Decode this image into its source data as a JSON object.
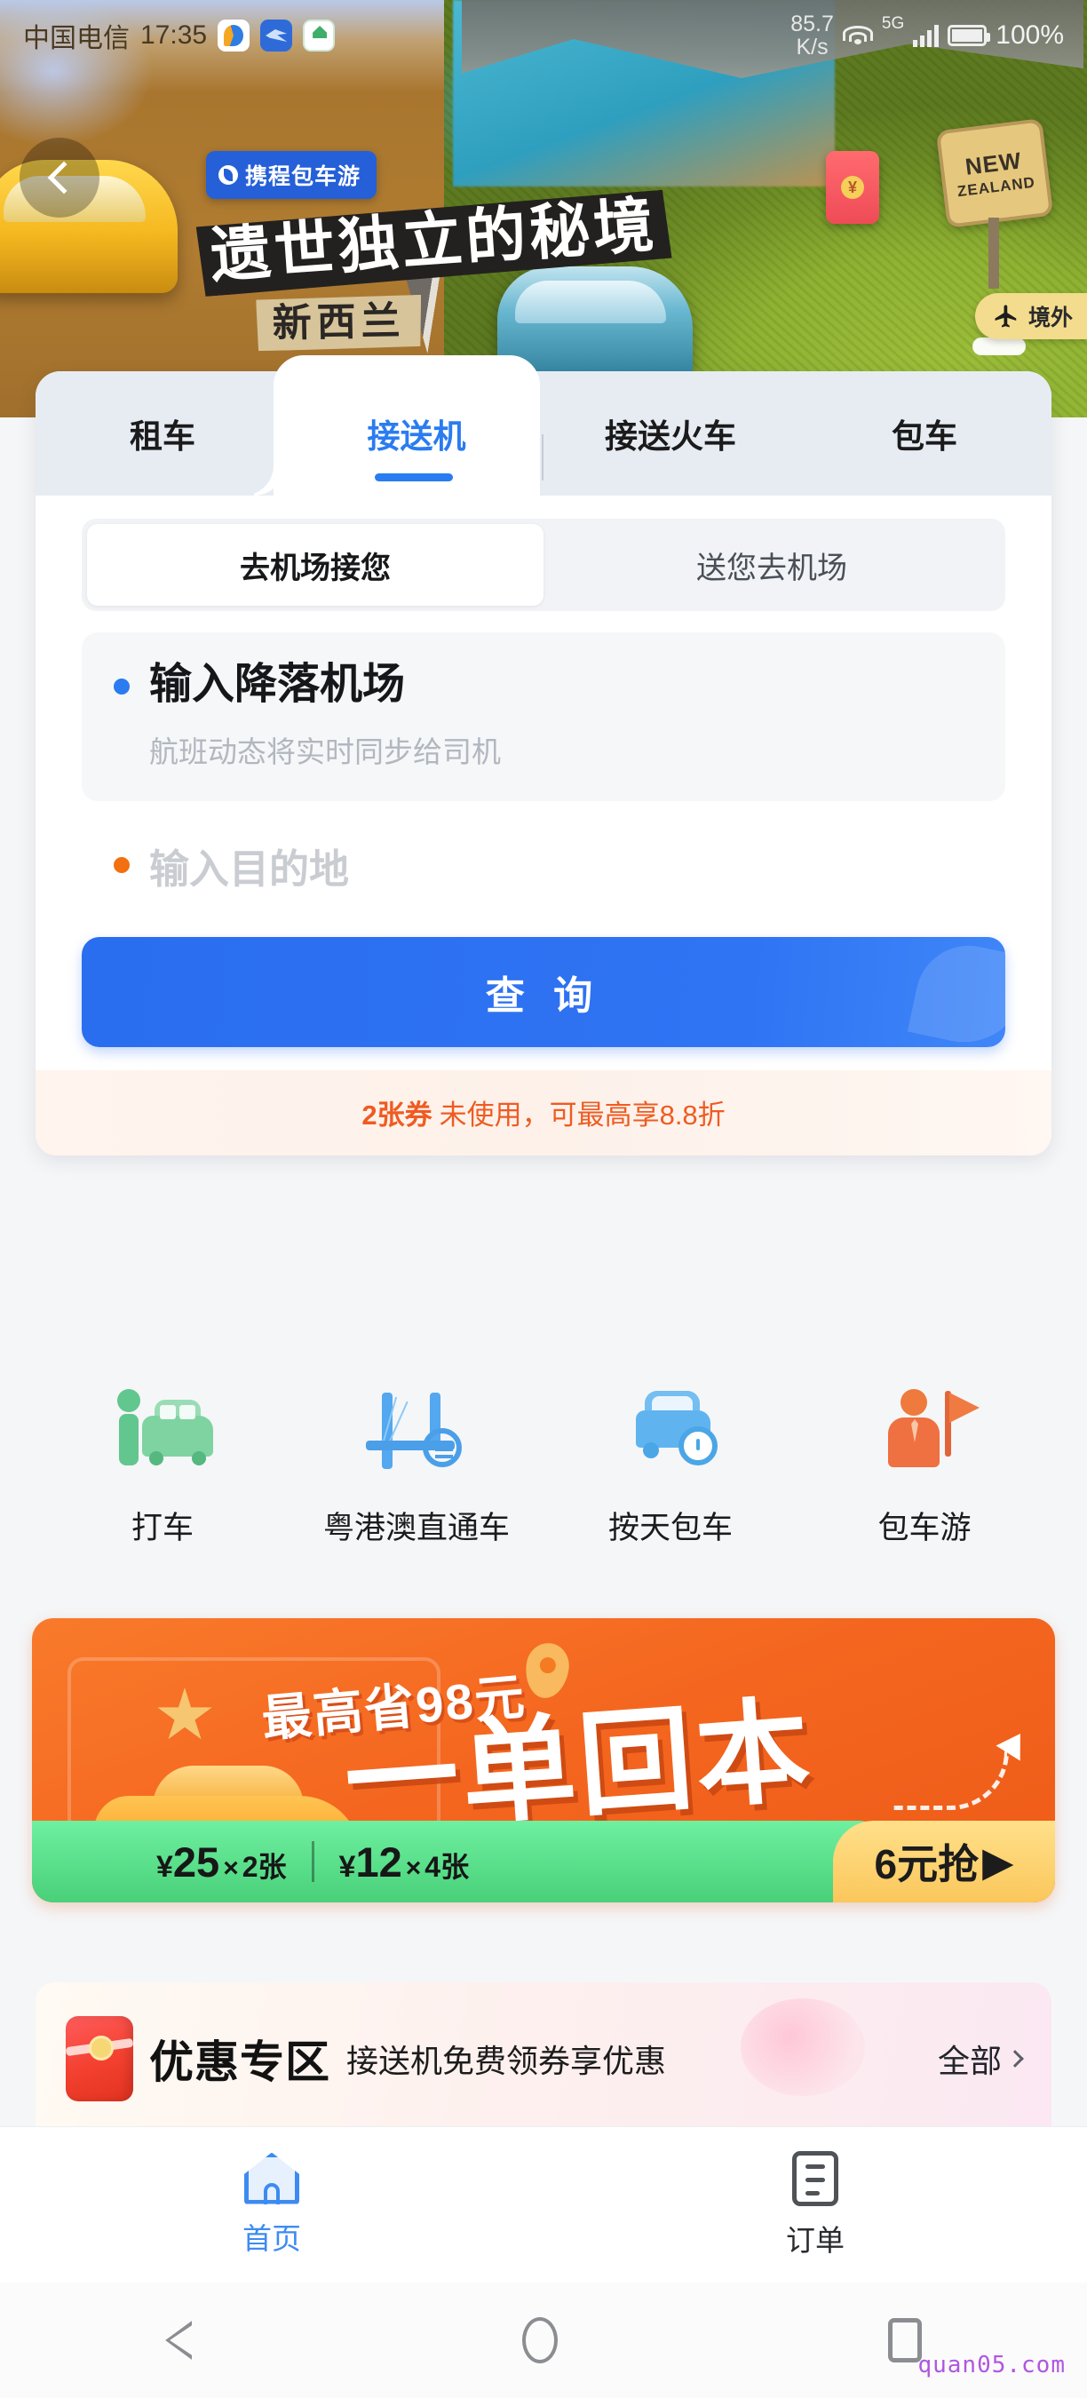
{
  "status_bar": {
    "carrier": "中国电信",
    "time": "17:35",
    "app_icons": [
      "wallet-icon",
      "swipe-icon",
      "vr-home-icon"
    ],
    "net_speed": "85.7",
    "net_speed_unit": "K/s",
    "network_type": "5G",
    "battery_percent": "100%"
  },
  "hero": {
    "brand_badge": "携程包车游",
    "title_line1": "遗世独立的秘境",
    "title_line2": "新西兰",
    "sign_line1": "NEW",
    "sign_line2": "ZEALAND",
    "coupon_symbol": "¥",
    "overseas_pill": "境外",
    "back_label": "返回"
  },
  "tabs": {
    "items": [
      {
        "label": "租车",
        "active": false
      },
      {
        "label": "接送机",
        "active": true
      },
      {
        "label": "接送火车",
        "active": false
      },
      {
        "label": "包车",
        "active": false
      }
    ]
  },
  "segment": {
    "options": [
      {
        "label": "去机场接您",
        "active": true
      },
      {
        "label": "送您去机场",
        "active": false
      }
    ]
  },
  "form": {
    "airport_field": {
      "value": "输入降落机场",
      "hint": "航班动态将实时同步给司机"
    },
    "destination_field": {
      "placeholder": "输入目的地"
    },
    "submit_label": "查 询"
  },
  "coupon_bar": {
    "count_label": "2张券",
    "rest_text": "未使用，可最高享8.8折",
    "color": "#ef5b22"
  },
  "services": [
    {
      "label": "打车",
      "icon": "taxi-person-icon"
    },
    {
      "label": "粤港澳直通车",
      "icon": "bridge-icon"
    },
    {
      "label": "按天包车",
      "icon": "car-clock-icon"
    },
    {
      "label": "包车游",
      "icon": "guide-flag-icon"
    }
  ],
  "promo": {
    "save_text": "最高省98元",
    "headline": "一单回本",
    "offer1_currency": "¥",
    "offer1_amount": "25",
    "offer1_x": "×",
    "offer1_count": "2张",
    "offer2_currency": "¥",
    "offer2_amount": "12",
    "offer2_x": "×",
    "offer2_count": "4张",
    "cta": "6元抢",
    "cta_arrow": "▶"
  },
  "youhui": {
    "title": "优惠专区",
    "subtitle": "接送机免费领券享优惠",
    "all_label": "全部"
  },
  "bottom_nav": [
    {
      "label": "首页",
      "icon": "home-icon",
      "active": true
    },
    {
      "label": "订单",
      "icon": "order-list-icon",
      "active": false
    }
  ],
  "android_nav": {
    "back": "back-triangle-icon",
    "home": "home-circle-icon",
    "recents": "recents-square-icon"
  },
  "watermark": "quan05.com"
}
